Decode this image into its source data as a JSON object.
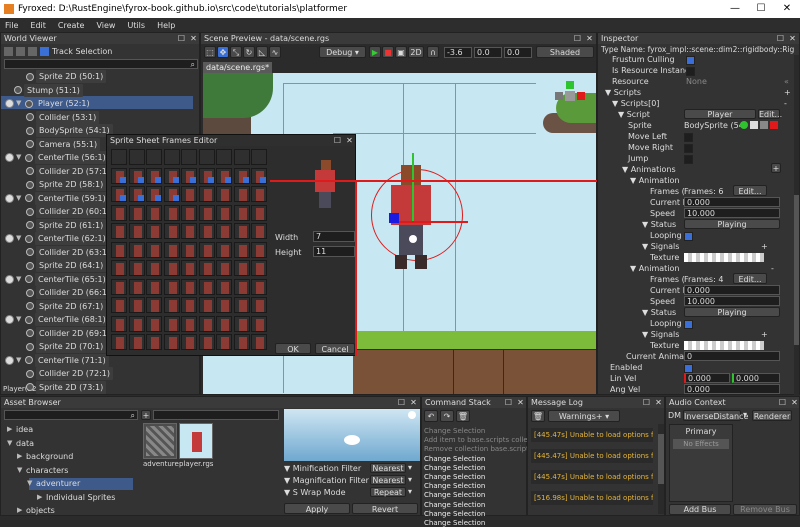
{
  "window": {
    "title": "Fyroxed: D:\\RustEngine\\fyrox-book.github.io\\src\\code\\tutorials\\platformer",
    "minimize": "—",
    "maximize": "☐",
    "close": "✕"
  },
  "menu": [
    "File",
    "Edit",
    "Create",
    "View",
    "Utils",
    "Help"
  ],
  "world_viewer": {
    "title": "World Viewer",
    "track_selection": "Track Selection",
    "status": "Player(52:1)",
    "nodes": [
      {
        "label": "Sprite 2D (50:1)",
        "indent": 2,
        "arrow": ""
      },
      {
        "label": "Stump (51:1)",
        "indent": 1,
        "arrow": ""
      },
      {
        "label": "Player (52:1)",
        "indent": 1,
        "arrow": "▼",
        "selected": true
      },
      {
        "label": "Collider (53:1)",
        "indent": 2,
        "arrow": ""
      },
      {
        "label": "BodySprite (54:1)",
        "indent": 2,
        "arrow": ""
      },
      {
        "label": "Camera (55:1)",
        "indent": 2,
        "arrow": ""
      },
      {
        "label": "CenterTile (56:1)",
        "indent": 1,
        "arrow": "▼"
      },
      {
        "label": "Collider 2D (57:1)",
        "indent": 2,
        "arrow": ""
      },
      {
        "label": "Sprite 2D (58:1)",
        "indent": 2,
        "arrow": ""
      },
      {
        "label": "CenterTile (59:1)",
        "indent": 1,
        "arrow": "▼"
      },
      {
        "label": "Collider 2D (60:1)",
        "indent": 2,
        "arrow": ""
      },
      {
        "label": "Sprite 2D (61:1)",
        "indent": 2,
        "arrow": ""
      },
      {
        "label": "CenterTile (62:1)",
        "indent": 1,
        "arrow": "▼"
      },
      {
        "label": "Collider 2D (63:1)",
        "indent": 2,
        "arrow": ""
      },
      {
        "label": "Sprite 2D (64:1)",
        "indent": 2,
        "arrow": ""
      },
      {
        "label": "CenterTile (65:1)",
        "indent": 1,
        "arrow": "▼"
      },
      {
        "label": "Collider 2D (66:1)",
        "indent": 2,
        "arrow": ""
      },
      {
        "label": "Sprite 2D (67:1)",
        "indent": 2,
        "arrow": ""
      },
      {
        "label": "CenterTile (68:1)",
        "indent": 1,
        "arrow": "▼"
      },
      {
        "label": "Collider 2D (69:1)",
        "indent": 2,
        "arrow": ""
      },
      {
        "label": "Sprite 2D (70:1)",
        "indent": 2,
        "arrow": ""
      },
      {
        "label": "CenterTile (71:1)",
        "indent": 1,
        "arrow": "▼"
      },
      {
        "label": "Collider 2D (72:1)",
        "indent": 2,
        "arrow": ""
      },
      {
        "label": "Sprite 2D (73:1)",
        "indent": 2,
        "arrow": ""
      }
    ]
  },
  "scene_preview": {
    "title": "Scene Preview - data/scene.rgs",
    "tab": "data/scene.rgs*",
    "mode": "Debug",
    "dim": "2D",
    "x": "-3.6",
    "y": "0.0",
    "z": "0.0",
    "shading": "Shaded"
  },
  "sprite_editor": {
    "title": "Sprite Sheet Frames Editor",
    "width_label": "Width",
    "width_value": "7",
    "height_label": "Height",
    "height_value": "11",
    "ok": "OK",
    "cancel": "Cancel"
  },
  "inspector": {
    "title": "Inspector",
    "type_name": "Type Name: fyrox_impl::scene::dim2::rigidbody::Rig",
    "frustum_culling": "Frustum Culling",
    "is_resource_instance": "Is Resource Instanc",
    "resource": "Resource",
    "resource_value": "None",
    "scripts": "Scripts",
    "scripts0": "Scripts[0]",
    "script": "Script",
    "script_value": "Player",
    "edit": "Edit...",
    "sprite": "Sprite",
    "sprite_value": "BodySprite (54:",
    "move_left": "Move Left",
    "move_right": "Move Right",
    "jump": "Jump",
    "animations": "Animations",
    "animation": "Animation",
    "frames": "Frames (",
    "frames_value": "Frames: 6",
    "frames_value2": "Frames: 4",
    "edit_btn": "Edit...",
    "current_f": "Current F",
    "current_value": "0.000",
    "speed": "Speed",
    "speed_value": "10.000",
    "status": "Status",
    "status_value": "Playing",
    "looping": "Looping",
    "signals": "Signals",
    "texture": "Texture",
    "current_anim": "Current Animat",
    "current_anim_value": "0",
    "enabled": "Enabled",
    "lin_vel": "Lin Vel",
    "lin_x": "0.000",
    "lin_y": "0.000",
    "ang_vel": "Ang Vel",
    "ang_value": "0.000",
    "plus": "+",
    "minus": "-"
  },
  "asset_browser": {
    "title": "Asset Browser",
    "tree": [
      {
        "label": "idea",
        "indent": 1,
        "arrow": "▶"
      },
      {
        "label": "data",
        "indent": 1,
        "arrow": "▼"
      },
      {
        "label": "background",
        "indent": 2,
        "arrow": "▶"
      },
      {
        "label": "characters",
        "indent": 2,
        "arrow": "▼"
      },
      {
        "label": "adventurer",
        "indent": 3,
        "arrow": "▼",
        "selected": true
      },
      {
        "label": "Individual Sprites",
        "indent": 4,
        "arrow": "▶"
      },
      {
        "label": "objects",
        "indent": 2,
        "arrow": "▶"
      }
    ],
    "files": [
      "adventure",
      "player.rgs"
    ],
    "minification_filter": "Minification Filter",
    "magnification_filter": "Magnification Filter",
    "s_wrap_mode": "S Wrap Mode",
    "nearest": "Nearest",
    "repeat": "Repeat",
    "apply": "Apply",
    "revert": "Revert"
  },
  "command_stack": {
    "title": "Command Stack",
    "items_dim": [
      "Change Selection",
      "Add item to base.scripts colle",
      "Remove collection base.script"
    ],
    "items": [
      "Change Selection",
      "Change Selection",
      "Change Selection",
      "Change Selection",
      "Change Selection",
      "Change Selection",
      "Change Selection",
      "Change Selection"
    ]
  },
  "message_log": {
    "title": "Message Log",
    "filter": "Warnings+",
    "items": [
      "[445.47s] Unable to load options fi",
      "[445.47s] Unable to load options fi",
      "[445.47s] Unable to load options fi",
      "[516.98s] Unable to load options fi"
    ]
  },
  "audio_context": {
    "title": "Audio Context",
    "dm": "DM",
    "distance": "InverseDistance",
    "renderer": "Renderer",
    "primary": "Primary",
    "no_effects": "No Effects",
    "add_bus": "Add Bus",
    "remove_bus": "Remove Bus"
  },
  "colors": {
    "accent": "#3a6fd8",
    "highlight": "#e01a1a",
    "selection": "#3d5a8a",
    "sky": "#c7e7f3"
  }
}
